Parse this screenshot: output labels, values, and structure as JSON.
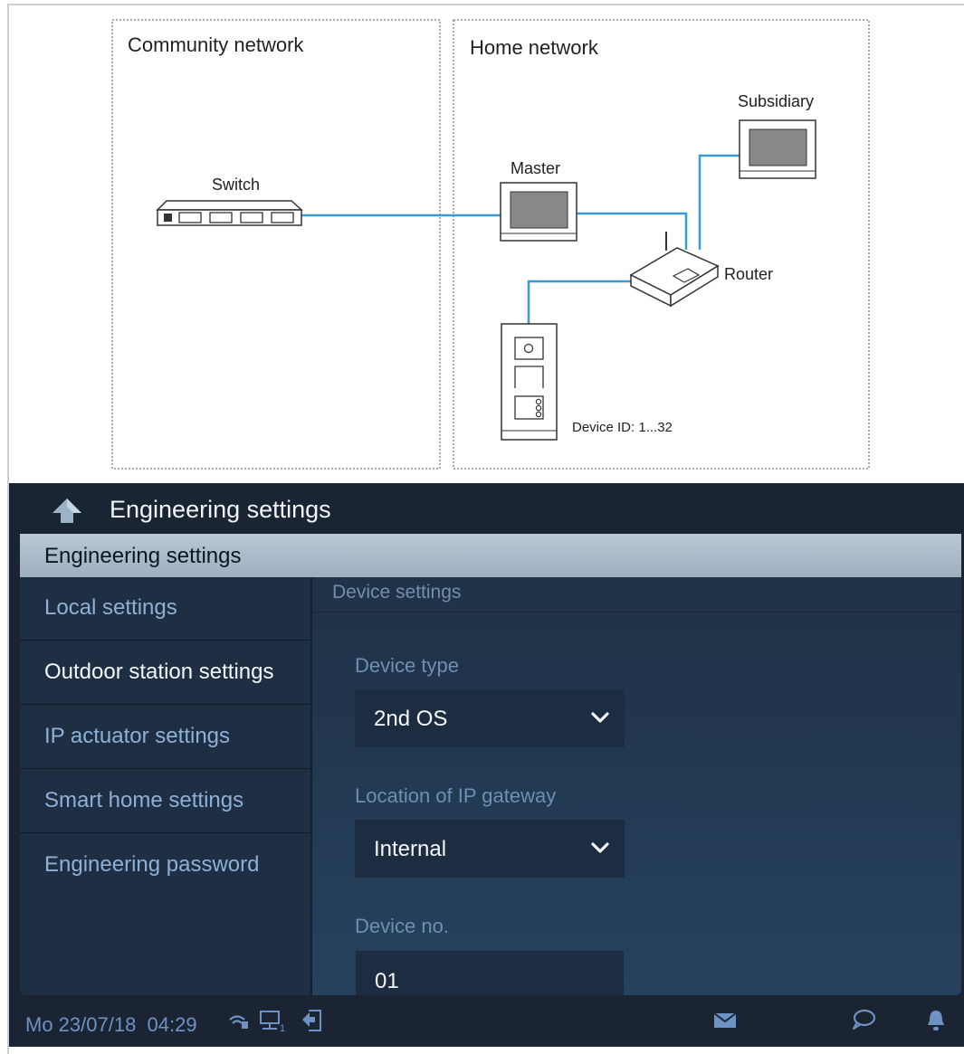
{
  "diagram": {
    "community_network_label": "Community network",
    "home_network_label": "Home network",
    "switch_label": "Switch",
    "master_label": "Master",
    "subsidiary_label": "Subsidiary",
    "router_label": "Router",
    "device_id_label": "Device ID: 1...32",
    "line_color": "#3a9bd0"
  },
  "topbar": {
    "title": "Engineering settings",
    "back_icon": "back-arrow-icon"
  },
  "panel": {
    "header": "Engineering settings",
    "sidebar_items": [
      {
        "label": "Local settings",
        "active": false
      },
      {
        "label": "Outdoor station settings",
        "active": true
      },
      {
        "label": "IP actuator settings",
        "active": false
      },
      {
        "label": "Smart home settings",
        "active": false
      },
      {
        "label": "Engineering password",
        "active": false
      }
    ],
    "section_title": "Device settings",
    "fields": {
      "device_type": {
        "label": "Device type",
        "value": "2nd OS"
      },
      "ip_gateway": {
        "label": "Location of IP gateway",
        "value": "Internal"
      },
      "device_no": {
        "label": "Device no.",
        "value": "01"
      }
    }
  },
  "statusbar": {
    "datetime": "Mo 23/07/18  04:29",
    "icons": [
      "wifi-icon",
      "network-icon",
      "exit-icon",
      "mail-icon",
      "chat-icon",
      "bell-icon"
    ],
    "network_count": "1"
  },
  "colors": {
    "screen_bg": "#1b2432",
    "sidebar_active_text": "#f4f6f8",
    "sidebar_text": "#8fb0d6",
    "status_icon": "#6d92c4"
  }
}
